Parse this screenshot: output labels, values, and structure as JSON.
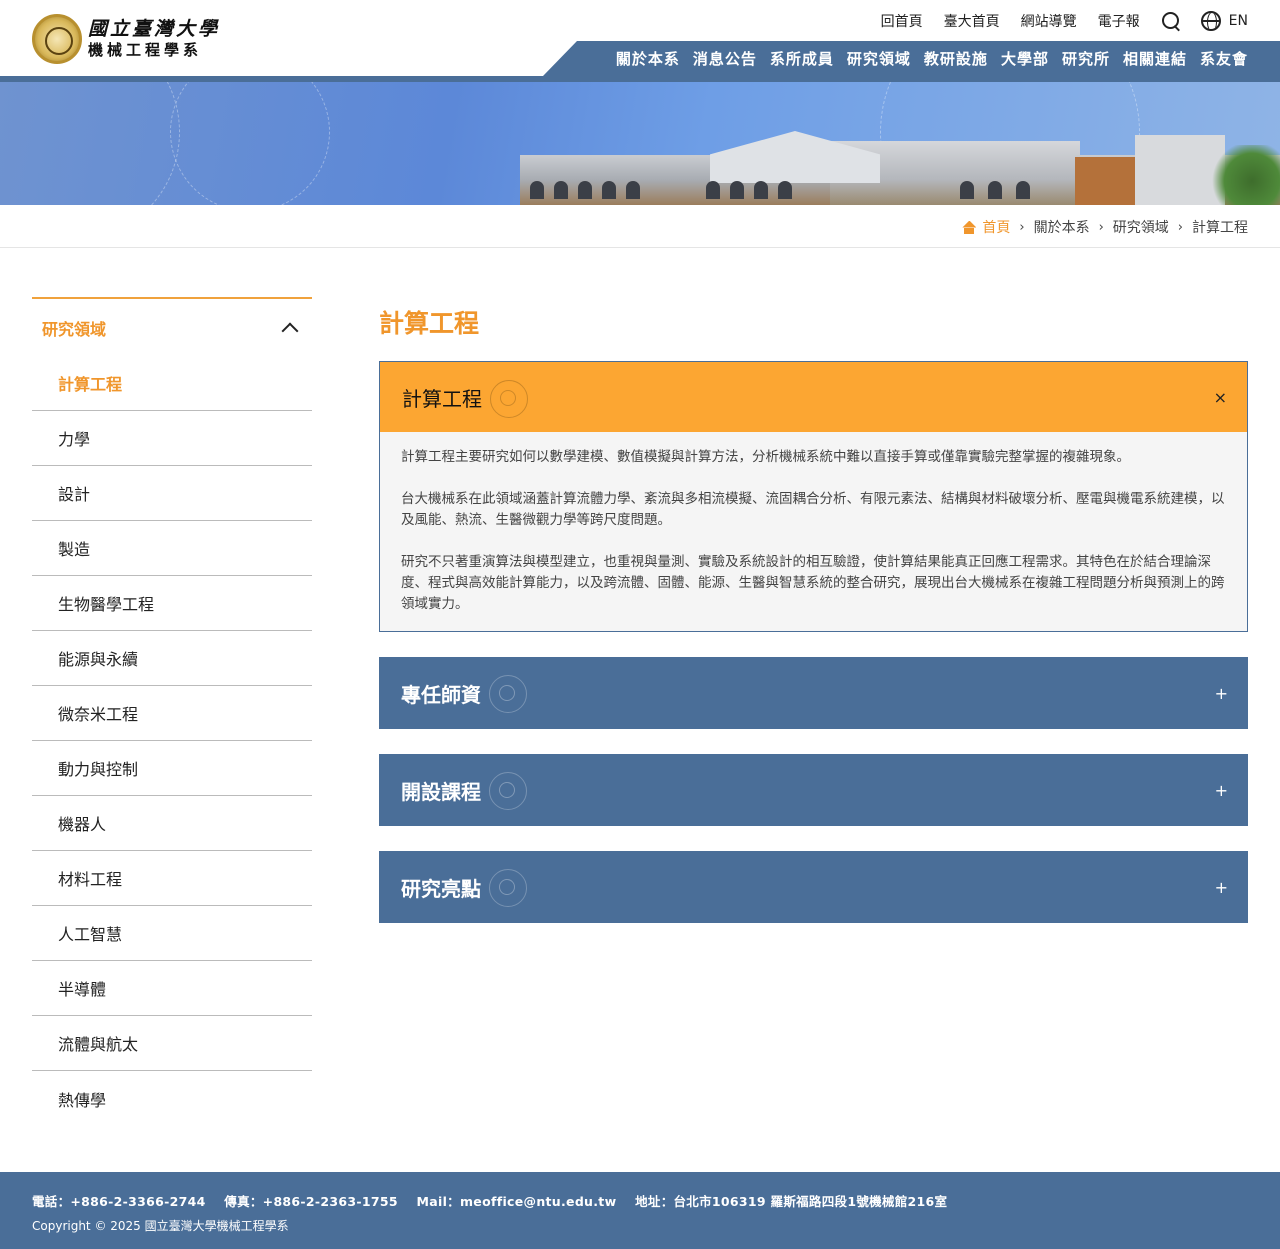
{
  "site": {
    "name_line1": "國立臺灣大學",
    "name_line2": "機械工程學系"
  },
  "utility_links": [
    "回首頁",
    "臺大首頁",
    "網站導覽",
    "電子報"
  ],
  "lang_label": "EN",
  "nav": [
    "關於本系",
    "消息公告",
    "系所成員",
    "研究領域",
    "教研設施",
    "大學部",
    "研究所",
    "相關連結",
    "系友會"
  ],
  "breadcrumb": [
    "首頁",
    "關於本系",
    "研究領域",
    "計算工程"
  ],
  "sidebar": {
    "title": "研究領域",
    "items": [
      "計算工程",
      "力學",
      "設計",
      "製造",
      "生物醫學工程",
      "能源與永續",
      "微奈米工程",
      "動力與控制",
      "機器人",
      "材料工程",
      "人工智慧",
      "半導體",
      "流體與航太",
      "熱傳學"
    ]
  },
  "page_title": "計算工程",
  "panels": [
    {
      "title": "計算工程",
      "toggle": "×",
      "paragraphs": [
        "計算工程主要研究如何以數學建模、數值模擬與計算方法，分析機械系統中難以直接手算或僅靠實驗完整掌握的複雜現象。",
        "台大機械系在此領域涵蓋計算流體力學、紊流與多相流模擬、流固耦合分析、有限元素法、結構與材料破壞分析、壓電與機電系統建模，以及風能、熱流、生醫微觀力學等跨尺度問題。",
        "研究不只著重演算法與模型建立，也重視與量測、實驗及系統設計的相互驗證，使計算結果能真正回應工程需求。其特色在於結合理論深度、程式與高效能計算能力，以及跨流體、固體、能源、生醫與智慧系統的整合研究，展現出台大機械系在複雜工程問題分析與預測上的跨領域實力。"
      ]
    },
    {
      "title": "專任師資",
      "toggle": "+"
    },
    {
      "title": "開設課程",
      "toggle": "+"
    },
    {
      "title": "研究亮點",
      "toggle": "+"
    }
  ],
  "footer": {
    "phone": "電話：+886-2-3366-2744",
    "fax": "傳真：+886-2-2363-1755",
    "mail": "Mail：meoffice@ntu.edu.tw",
    "address": "地址：台北市106319 羅斯福路四段1號機械館216室",
    "copyright": "Copyright © 2025 國立臺灣大學機械工程學系"
  },
  "colors": {
    "accent_orange": "#f0962c",
    "panel_open": "#fca632",
    "navy": "#4a6e98"
  }
}
